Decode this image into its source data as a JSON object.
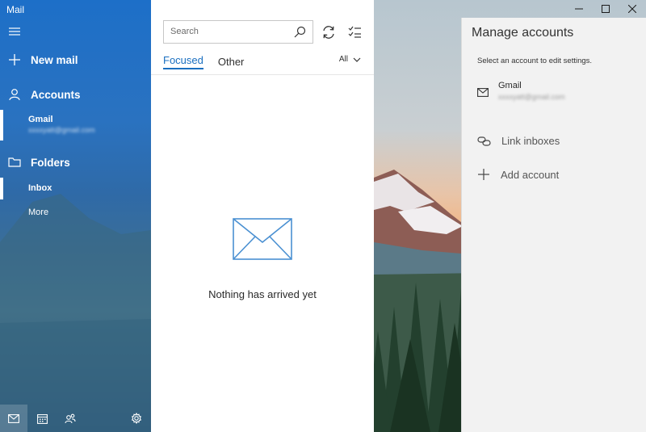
{
  "app": {
    "title": "Mail"
  },
  "nav": {
    "new_mail": "New mail",
    "accounts_label": "Accounts",
    "account": {
      "name": "Gmail",
      "email": "xxxxyatt@gmail.com"
    },
    "folders_label": "Folders",
    "folder_selected": "Inbox",
    "more": "More"
  },
  "list": {
    "search_placeholder": "Search",
    "tabs": {
      "focused": "Focused",
      "other": "Other"
    },
    "filter": "All",
    "empty_message": "Nothing has arrived yet"
  },
  "manage": {
    "title": "Manage accounts",
    "hint": "Select an account to edit settings.",
    "account": {
      "name": "Gmail",
      "email": "xxxxyatt@gmail.com"
    },
    "link_inboxes": "Link inboxes",
    "add_account": "Add account"
  },
  "colors": {
    "accent": "#1a6fc0",
    "nav_top": "#1d6fc8",
    "panel_bg": "#f2f2f2"
  }
}
